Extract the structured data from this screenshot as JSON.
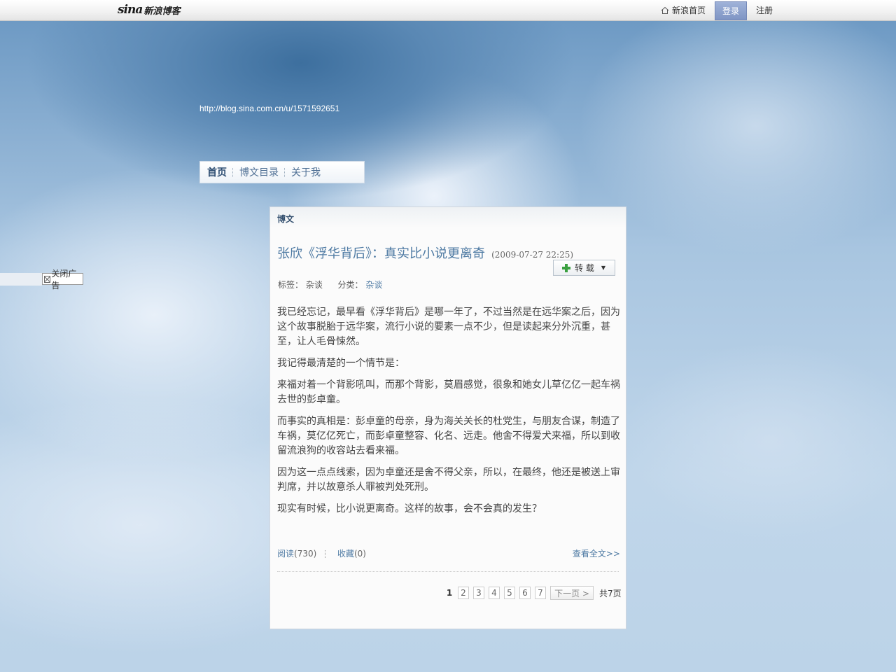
{
  "topbar": {
    "logo_brand": "sina",
    "logo_text": "新浪博客",
    "home_link": "新浪首页",
    "login": "登录",
    "register": "注册"
  },
  "blog": {
    "url": "http://blog.sina.com.cn/u/1571592651",
    "nav": [
      "首页",
      "博文目录",
      "关于我"
    ]
  },
  "ad": {
    "close_label": "关闭广告"
  },
  "post_panel": {
    "header": "博文",
    "title": "张欣《浮华背后》：真实比小说更离奇",
    "time": "(2009-07-27 22:25)",
    "repost_label": "转 载",
    "tags_label": "标签：",
    "tag": "杂谈",
    "category_label": "分类：",
    "category": "杂谈",
    "paragraphs": [
      "我已经忘记，最早看《浮华背后》是哪一年了，不过当然是在远华案之后，因为这个故事脱胎于远华案，流行小说的要素一点不少，但是读起来分外沉重，甚至，让人毛骨悚然。",
      "我记得最清楚的一个情节是：",
      "来福对着一个背影吼叫，而那个背影，莫眉感觉，很象和她女儿草亿亿一起车祸去世的彭卓童。",
      "而事实的真相是：彭卓童的母亲，身为海关关长的杜党生，与朋友合谋，制造了车祸，莫亿亿死亡，而彭卓童整容、化名、远走。他舍不得爱犬来福，所以到收留流浪狗的收容站去看来福。",
      "因为这一点点线索，因为卓童还是舍不得父亲，所以，在最终，他还是被送上审判席，并以故意杀人罪被判处死刑。",
      "现实有时候，比小说更离奇。这样的故事，会不会真的发生？"
    ],
    "read_label": "阅读",
    "read_count": "(730)",
    "fav_label": "收藏",
    "fav_count": "(0)",
    "read_more": "查看全文>>"
  },
  "pager": {
    "current": "1",
    "pages": [
      "2",
      "3",
      "4",
      "5",
      "6",
      "7"
    ],
    "next": "下一页 >",
    "total": "共7页"
  }
}
